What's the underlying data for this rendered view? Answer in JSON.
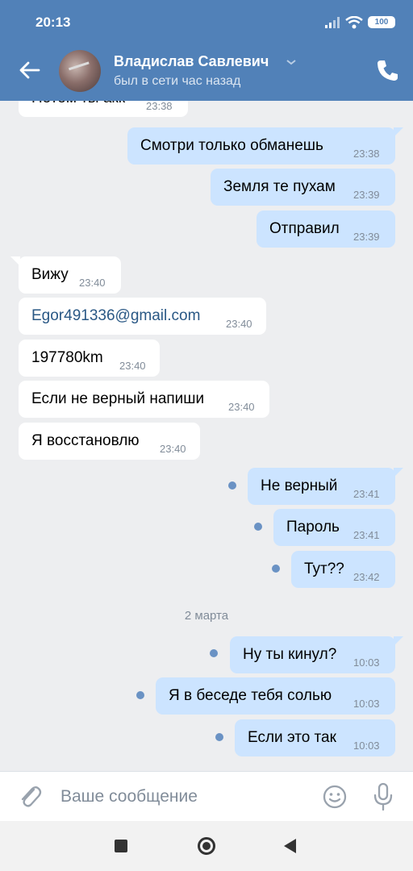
{
  "status_bar": {
    "time": "20:13",
    "battery": "100"
  },
  "header": {
    "name": "Владислав Савлевич",
    "last_seen": "был в сети час назад"
  },
  "messages": [
    {
      "dir": "in",
      "text": "Потом ты акк",
      "time": "23:38"
    },
    {
      "dir": "out",
      "text": "Смотри только обманешь",
      "time": "23:38"
    },
    {
      "dir": "out",
      "text": "Земля те пухам",
      "time": "23:39"
    },
    {
      "dir": "out",
      "text": "Отправил",
      "time": "23:39"
    },
    {
      "dir": "in",
      "text": "Вижу",
      "time": "23:40"
    },
    {
      "dir": "in",
      "text": "Egor491336@gmail.com",
      "time": "23:40"
    },
    {
      "dir": "in",
      "text": "197780km",
      "time": "23:40"
    },
    {
      "dir": "in",
      "text": "Если не верный напиши",
      "time": "23:40"
    },
    {
      "dir": "in",
      "text": "Я восстановлю",
      "time": "23:40"
    },
    {
      "dir": "out",
      "text": "Не верный",
      "time": "23:41",
      "unread": true
    },
    {
      "dir": "out",
      "text": "Пароль",
      "time": "23:41",
      "unread": true
    },
    {
      "dir": "out",
      "text": "Тут??",
      "time": "23:42",
      "unread": true
    },
    {
      "dir": "out",
      "text": "Ну ты кинул?",
      "time": "10:03",
      "unread": true
    },
    {
      "dir": "out",
      "text": "Я в беседе тебя солью",
      "time": "10:03",
      "unread": true
    },
    {
      "dir": "out",
      "text": "Если это так",
      "time": "10:03",
      "unread": true
    }
  ],
  "date_separator": "2 марта",
  "composer": {
    "placeholder": "Ваше сообщение"
  },
  "icons": {
    "back": "arrow-left-icon",
    "call": "phone-icon",
    "attach": "paperclip-icon",
    "emoji": "smile-icon",
    "voice": "microphone-icon"
  },
  "colors": {
    "header_bg": "#5181b8",
    "incoming_bubble": "#ffffff",
    "outgoing_bubble": "#cce4ff",
    "chat_bg": "#edeef0",
    "link": "#2a5885"
  }
}
